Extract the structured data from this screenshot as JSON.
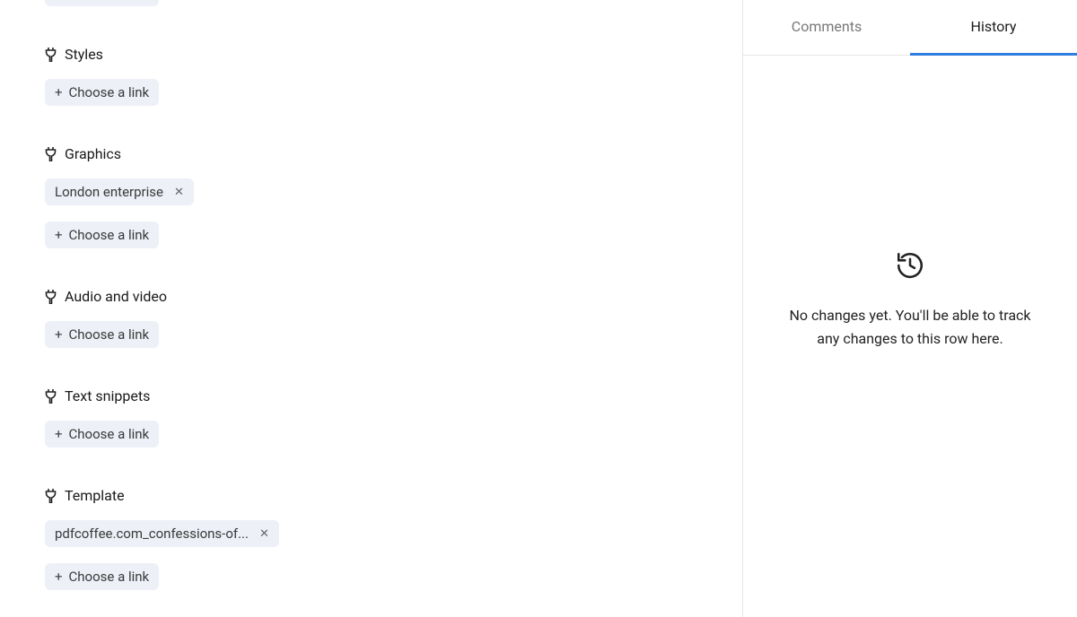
{
  "chooseLinkLabel": "Choose a link",
  "sections": [
    {
      "label": "Styles",
      "tags": []
    },
    {
      "label": "Graphics",
      "tags": [
        "London enterprise"
      ]
    },
    {
      "label": "Audio and video",
      "tags": []
    },
    {
      "label": "Text snippets",
      "tags": []
    },
    {
      "label": "Template",
      "tags": [
        "pdfcoffee.com_confessions-of..."
      ]
    }
  ],
  "sidebar": {
    "tabs": {
      "comments": "Comments",
      "history": "History"
    },
    "activeTab": "history",
    "history": {
      "emptyText": "No changes yet. You'll be able to track any changes to this row here."
    }
  }
}
